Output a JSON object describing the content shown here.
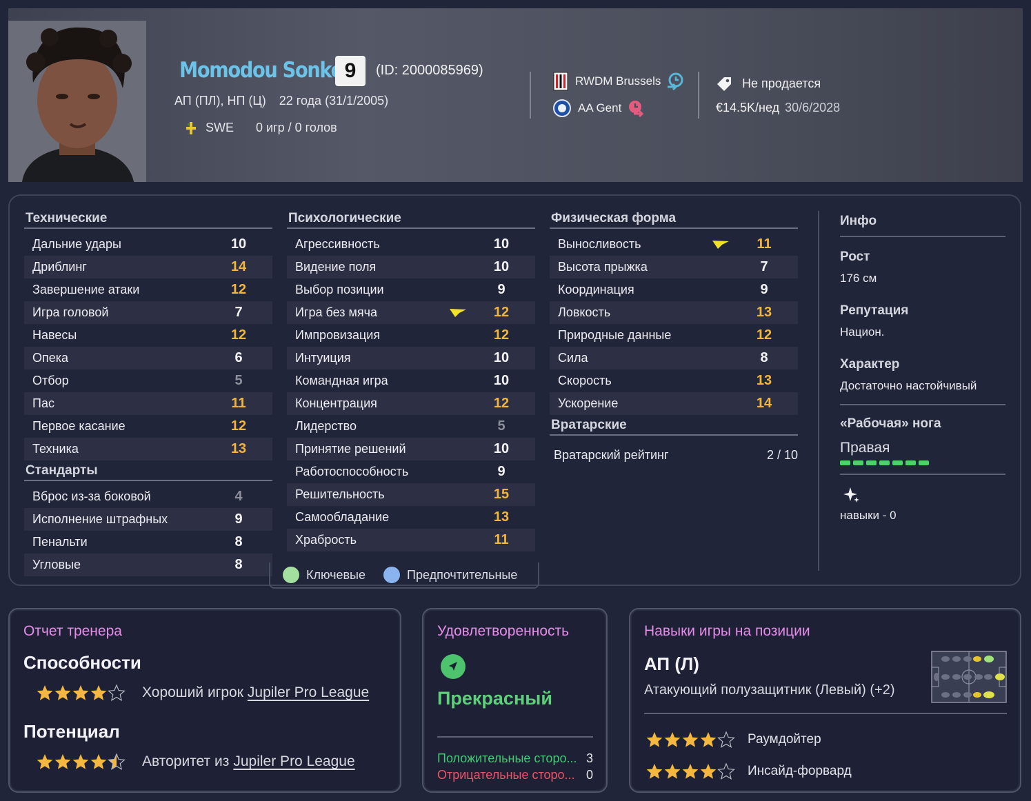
{
  "header": {
    "name": "Momodou Sonko",
    "number": "9",
    "id_text": "(ID: 2000085969)",
    "positions": "АП (ПЛ), НП (Ц)",
    "age": "22 года (31/1/2005)",
    "nation": "SWE",
    "caps": "0 игр / 0 голов",
    "club": "RWDM Brussels",
    "parent_club": "AA Gent",
    "transfer_status": "Не продается",
    "wage": "€14.5K/нед",
    "contract_end": "30/6/2028"
  },
  "technical": {
    "title": "Технические",
    "rows": [
      {
        "label": "Дальние удары",
        "value": "10",
        "tone": "white"
      },
      {
        "label": "Дриблинг",
        "value": "14",
        "tone": "orange"
      },
      {
        "label": "Завершение атаки",
        "value": "12",
        "tone": "orange"
      },
      {
        "label": "Игра головой",
        "value": "7",
        "tone": "white"
      },
      {
        "label": "Навесы",
        "value": "12",
        "tone": "orange"
      },
      {
        "label": "Опека",
        "value": "6",
        "tone": "white"
      },
      {
        "label": "Отбор",
        "value": "5",
        "tone": "grey"
      },
      {
        "label": "Пас",
        "value": "11",
        "tone": "orange"
      },
      {
        "label": "Первое касание",
        "value": "12",
        "tone": "orange"
      },
      {
        "label": "Техника",
        "value": "13",
        "tone": "orange"
      }
    ]
  },
  "set_pieces": {
    "title": "Стандарты",
    "rows": [
      {
        "label": "Вброс из-за боковой",
        "value": "4",
        "tone": "grey"
      },
      {
        "label": "Исполнение штрафных",
        "value": "9",
        "tone": "white"
      },
      {
        "label": "Пенальти",
        "value": "8",
        "tone": "white"
      },
      {
        "label": "Угловые",
        "value": "8",
        "tone": "white"
      }
    ]
  },
  "mental": {
    "title": "Психологические",
    "rows": [
      {
        "label": "Агрессивность",
        "value": "10",
        "tone": "white"
      },
      {
        "label": "Видение поля",
        "value": "10",
        "tone": "white"
      },
      {
        "label": "Выбор позиции",
        "value": "9",
        "tone": "white"
      },
      {
        "label": "Игра без мяча",
        "value": "12",
        "tone": "orange",
        "arrow": true
      },
      {
        "label": "Импровизация",
        "value": "12",
        "tone": "orange"
      },
      {
        "label": "Интуиция",
        "value": "10",
        "tone": "white"
      },
      {
        "label": "Командная игра",
        "value": "10",
        "tone": "white"
      },
      {
        "label": "Концентрация",
        "value": "12",
        "tone": "orange"
      },
      {
        "label": "Лидерство",
        "value": "5",
        "tone": "grey"
      },
      {
        "label": "Принятие решений",
        "value": "10",
        "tone": "white"
      },
      {
        "label": "Работоспособность",
        "value": "9",
        "tone": "white"
      },
      {
        "label": "Решительность",
        "value": "15",
        "tone": "orange"
      },
      {
        "label": "Самообладание",
        "value": "13",
        "tone": "orange"
      },
      {
        "label": "Храбрость",
        "value": "11",
        "tone": "orange"
      }
    ]
  },
  "physical": {
    "title": "Физическая форма",
    "rows": [
      {
        "label": "Выносливость",
        "value": "11",
        "tone": "orange",
        "arrow": true
      },
      {
        "label": "Высота прыжка",
        "value": "7",
        "tone": "white"
      },
      {
        "label": "Координация",
        "value": "9",
        "tone": "white"
      },
      {
        "label": "Ловкость",
        "value": "13",
        "tone": "orange"
      },
      {
        "label": "Природные данные",
        "value": "12",
        "tone": "orange"
      },
      {
        "label": "Сила",
        "value": "8",
        "tone": "white"
      },
      {
        "label": "Скорость",
        "value": "13",
        "tone": "orange"
      },
      {
        "label": "Ускорение",
        "value": "14",
        "tone": "orange"
      }
    ]
  },
  "goalkeeping": {
    "title": "Вратарские",
    "label": "Вратарский рейтинг",
    "value": "2 / 10"
  },
  "info": {
    "title": "Инфо",
    "height_label": "Рост",
    "height": "176 см",
    "reputation_label": "Репутация",
    "reputation": "Национ.",
    "personality_label": "Характер",
    "personality": "Достаточно настойчивый",
    "foot_label": "«Рабочая» нога",
    "foot": "Правая",
    "foot_level": 1.0,
    "skills": "навыки - 0"
  },
  "legend": {
    "key": "Ключевые",
    "preferred": "Предпочтительные",
    "key_color": "#a3e0a0",
    "preferred_color": "#8ab4f0"
  },
  "coach": {
    "title": "Отчет тренера",
    "ability_h": "Способности",
    "ability_stars": 4,
    "ability_prefix": "Хороший игрок",
    "ability_league": "Jupiler Pro League",
    "potential_h": "Потенциал",
    "potential_stars": 4.5,
    "potential_prefix": "Авторитет из",
    "potential_league": "Jupiler Pro League"
  },
  "happiness": {
    "title": "Удовлетворенность",
    "status": "Прекрасный",
    "positive_label": "Положительные сторо...",
    "positive_count": "3",
    "negative_label": "Отрицательные сторо...",
    "negative_count": "0"
  },
  "roles": {
    "title": "Навыки игры на позиции",
    "position": "АП (Л)",
    "position_full": "Атакующий полузащитник (Левый) (+2)",
    "items": [
      {
        "stars": 4,
        "label": "Раумдойтер"
      },
      {
        "stars": 4,
        "label": "Инсайд-форвард"
      }
    ]
  },
  "colors": {
    "accent_name": "#6cc3e8",
    "attr_high": "#f3b53c",
    "attr_low": "#8d909c",
    "card_title": "#e68ce8",
    "positive": "#4ed17a",
    "negative": "#f0556b",
    "star": "#f5b73f"
  }
}
